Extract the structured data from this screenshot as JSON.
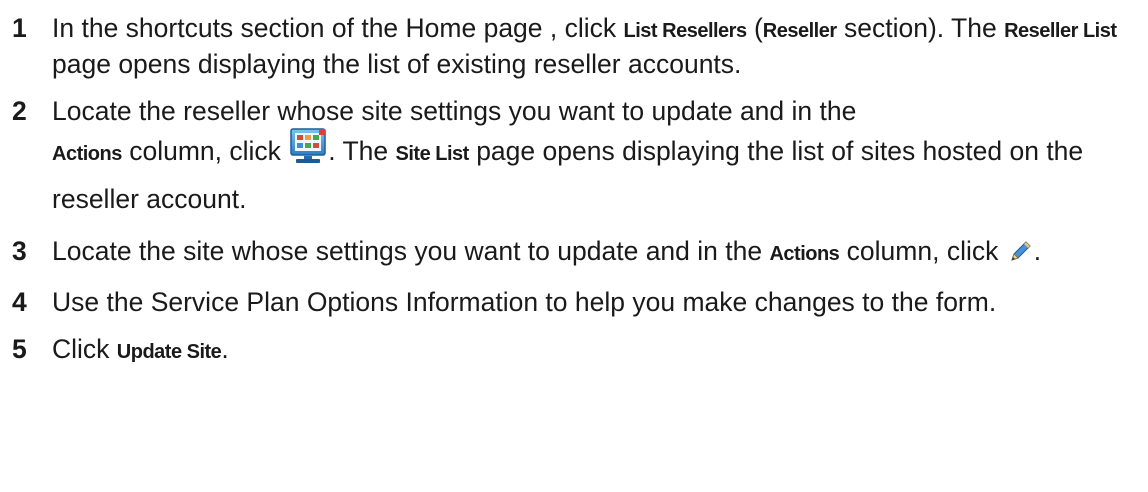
{
  "steps": [
    {
      "number": "1",
      "text_before": "In the shortcuts section of the Home page , click ",
      "ui_1": "List Resellers",
      "text_mid_1": " (",
      "ui_2": "Reseller",
      "text_mid_2": " section). The ",
      "ui_3": "Reseller List",
      "text_after": " page opens displaying the list of existing reseller accounts."
    },
    {
      "number": "2",
      "text_line1": "Locate the reseller whose site settings you want to update and in the",
      "ui_1": "Actions",
      "text_mid_1": " column, click ",
      "icon": "site-list-monitor-icon",
      "text_mid_2": ". The ",
      "ui_2": "Site List",
      "text_after": " page opens displaying the list of sites hosted on the reseller account."
    },
    {
      "number": "3",
      "text_before": "Locate the site whose settings you want to update and in the ",
      "ui_1": "Actions",
      "text_mid_1": " column, click ",
      "icon": "pencil-edit-icon",
      "text_after": "."
    },
    {
      "number": "4",
      "text": "Use the Service Plan Options Information to help you make changes to the form."
    },
    {
      "number": "5",
      "text_before": "Click ",
      "ui_1": "Update Site",
      "text_after": "."
    }
  ]
}
